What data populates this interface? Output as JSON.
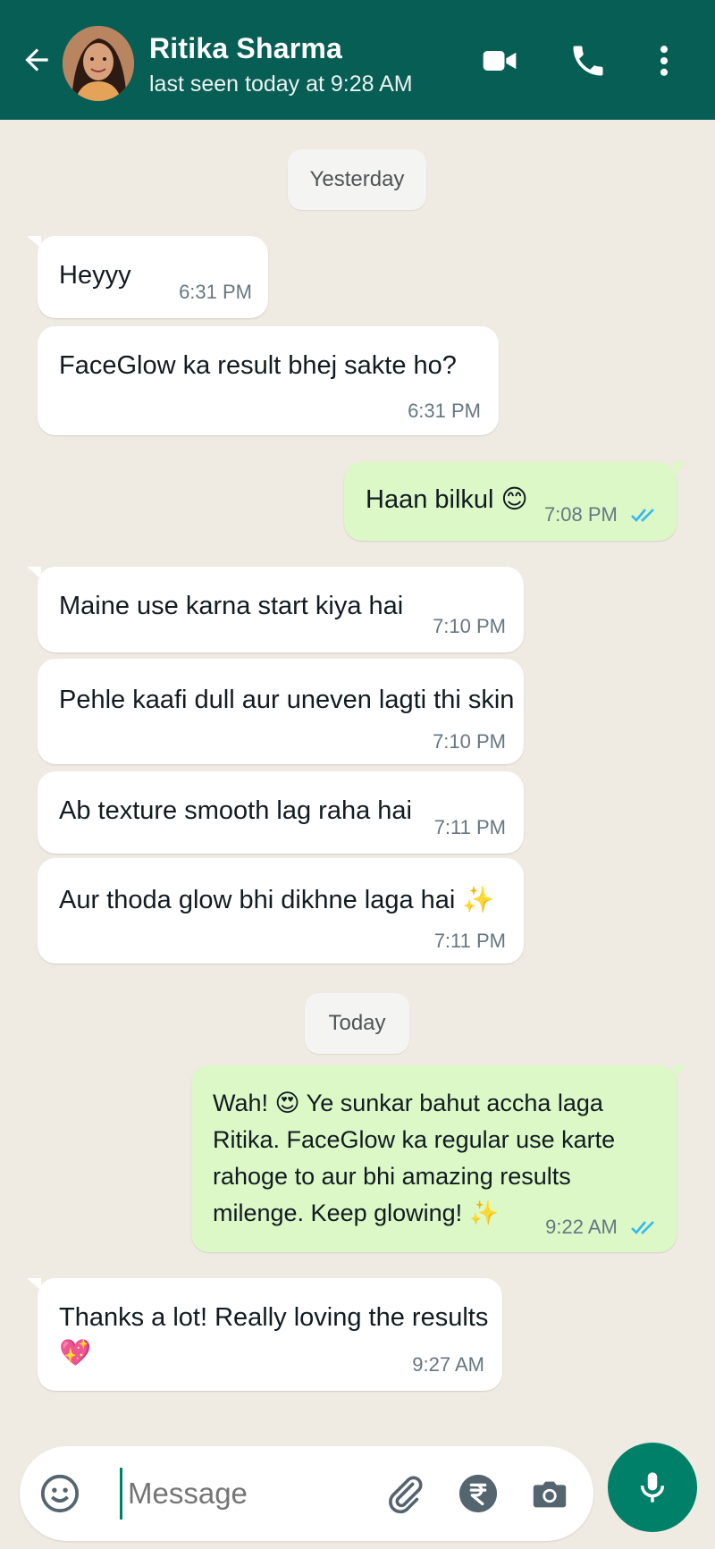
{
  "header": {
    "contact_name": "Ritika Sharma",
    "status": "last seen today at 9:28 AM",
    "back_icon": "arrow-left-icon",
    "video_icon": "video-camera-icon",
    "call_icon": "phone-icon",
    "menu_icon": "more-vertical-icon"
  },
  "chat": {
    "dates": [
      "Yesterday",
      "Today"
    ],
    "messages": [
      {
        "dir": "in",
        "text": "Heyyy",
        "time": "6:31 PM"
      },
      {
        "dir": "in",
        "text": "FaceGlow ka result bhej sakte ho?",
        "time": "6:31 PM"
      },
      {
        "dir": "out",
        "text": "Haan bilkul 😊",
        "time": "7:08 PM",
        "status": "read"
      },
      {
        "dir": "in",
        "text": "Maine use karna start kiya hai",
        "time": "7:10 PM"
      },
      {
        "dir": "in",
        "text": "Pehle kaafi dull aur uneven lagti thi skin",
        "time": "7:10 PM"
      },
      {
        "dir": "in",
        "text": "Ab texture smooth lag raha hai",
        "time": "7:11 PM"
      },
      {
        "dir": "in",
        "text": "Aur thoda glow bhi dikhne laga hai ✨",
        "time": "7:11 PM"
      },
      {
        "dir": "out",
        "lines": [
          "Wah! 😍 Ye sunkar bahut accha laga",
          "Ritika. FaceGlow ka regular use karte",
          "rahoge to aur bhi amazing results",
          "milenge. Keep glowing! ✨"
        ],
        "time": "9:22 AM",
        "status": "read"
      },
      {
        "dir": "in",
        "lines": [
          "Thanks a lot! Really loving the results",
          "💖"
        ],
        "time": "9:27 AM"
      }
    ]
  },
  "input": {
    "placeholder": "Message",
    "emoji_icon": "emoji-icon",
    "attach_icon": "paperclip-icon",
    "payment_icon": "rupee-icon",
    "camera_icon": "camera-icon",
    "mic_icon": "microphone-icon"
  },
  "colors": {
    "header": "#075e54",
    "outgoing_bubble": "#dcf8c6",
    "incoming_bubble": "#ffffff",
    "chat_background": "#efeae2",
    "read_ticks": "#34b7f1",
    "accent": "#008069"
  }
}
